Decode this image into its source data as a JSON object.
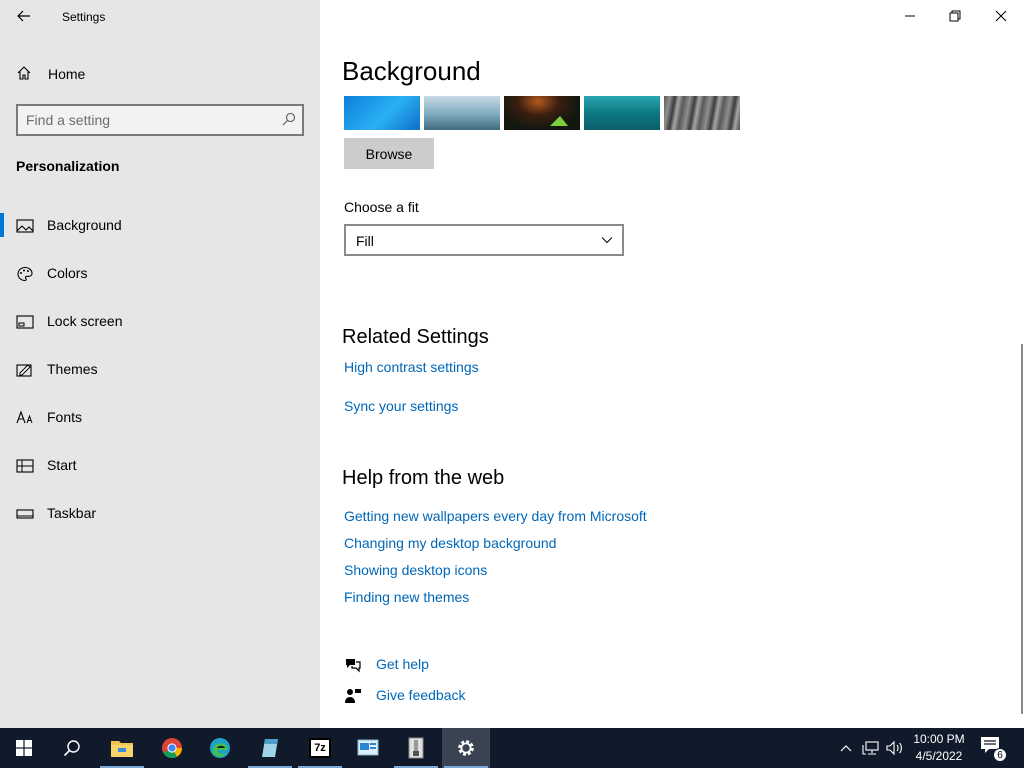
{
  "window": {
    "title": "Settings"
  },
  "sidebar": {
    "home_label": "Home",
    "search_placeholder": "Find a setting",
    "section_title": "Personalization",
    "items": [
      {
        "label": "Background",
        "icon": "picture-icon",
        "active": true
      },
      {
        "label": "Colors",
        "icon": "palette-icon"
      },
      {
        "label": "Lock screen",
        "icon": "lock-screen-icon"
      },
      {
        "label": "Themes",
        "icon": "themes-icon"
      },
      {
        "label": "Fonts",
        "icon": "fonts-icon"
      },
      {
        "label": "Start",
        "icon": "start-icon"
      },
      {
        "label": "Taskbar",
        "icon": "taskbar-icon"
      }
    ]
  },
  "main": {
    "title": "Background",
    "thumbnails": [
      {
        "name": "windows-blue",
        "color": "#1a9be6"
      },
      {
        "name": "beach-rider",
        "color": "#6f9fb4"
      },
      {
        "name": "night-tent",
        "color": "#1f2a14"
      },
      {
        "name": "underwater",
        "color": "#0e7f8a"
      },
      {
        "name": "rock-waterfall",
        "color": "#6b6b6b"
      }
    ],
    "browse_label": "Browse",
    "fit_label": "Choose a fit",
    "fit_value": "Fill",
    "related_title": "Related Settings",
    "related_links": [
      "High contrast settings",
      "Sync your settings"
    ],
    "help_title": "Help from the web",
    "help_links": [
      "Getting new wallpapers every day from Microsoft",
      "Changing my desktop background",
      "Showing desktop icons",
      "Finding new themes"
    ],
    "get_help": "Get help",
    "give_feedback": "Give feedback"
  },
  "taskbar": {
    "apps": [
      "start-icon",
      "search-icon",
      "file-explorer-icon",
      "chrome-icon",
      "edge-icon",
      "notepad-icon",
      "7zip-icon",
      "control-panel-icon",
      "archive-icon",
      "settings-icon"
    ],
    "zip_label": "7z",
    "time": "10:00 PM",
    "date": "4/5/2022",
    "notification_count": "6"
  },
  "colors": {
    "accent": "#0078d7",
    "link": "#0067b8",
    "sidebar_bg": "#e6e6e6",
    "taskbar_bg": "#101a2a"
  }
}
